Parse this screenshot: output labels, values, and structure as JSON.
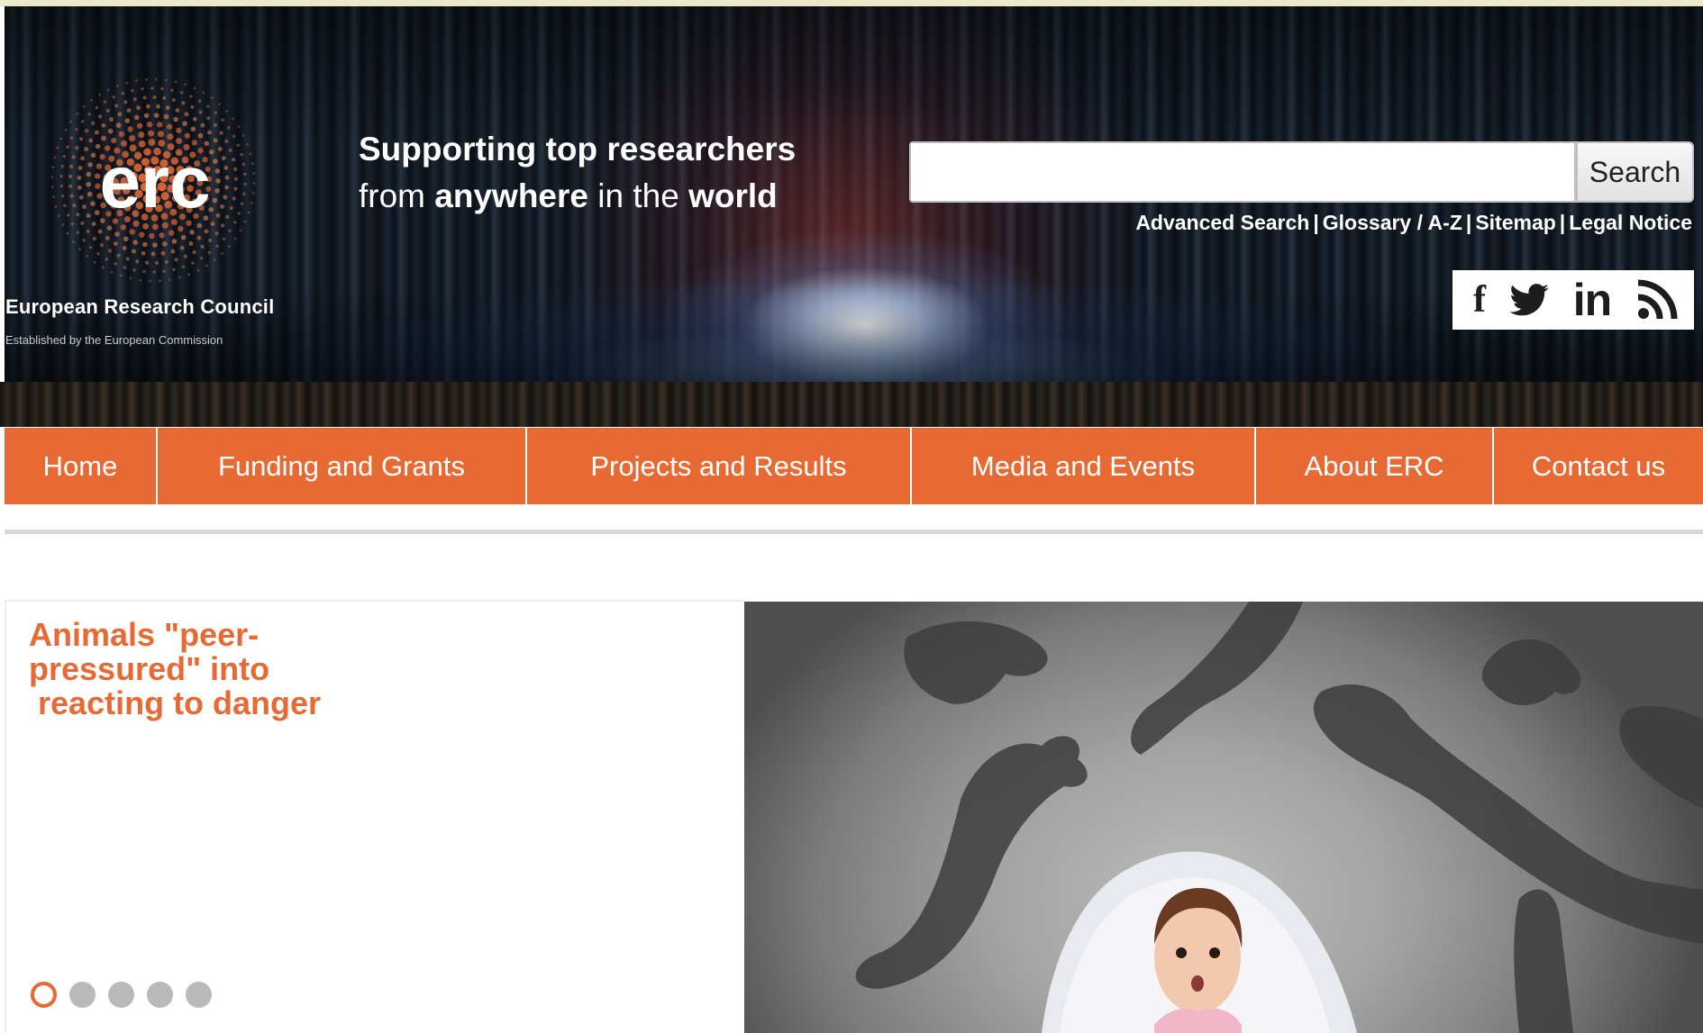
{
  "header": {
    "logo_text": "erc",
    "org_name": "European Research Council",
    "org_subtitle": "Established by the European Commission",
    "tagline": {
      "line1": "Supporting top researchers",
      "line2_prefix": "from ",
      "line2_bold1": "anywhere",
      "line2_mid": " in the ",
      "line2_bold2": "world"
    },
    "search": {
      "value": "",
      "placeholder": "",
      "button_label": "Search"
    },
    "util_links": [
      "Advanced Search",
      "Glossary / A-Z",
      "Sitemap",
      "Legal Notice"
    ],
    "social_icons": [
      "facebook-icon",
      "twitter-icon",
      "linkedin-icon",
      "rss-icon"
    ]
  },
  "nav": {
    "items": [
      {
        "label": "Home"
      },
      {
        "label": "Funding and Grants"
      },
      {
        "label": "Projects and Results"
      },
      {
        "label": "Media and Events"
      },
      {
        "label": "About ERC"
      },
      {
        "label": "Contact us"
      }
    ]
  },
  "slideshow": {
    "title": "Animals \"peer-\npressured\" into\n reacting to danger",
    "slide_count": 5,
    "active_slide": 1
  },
  "colors": {
    "accent": "#e76934",
    "dot_inactive": "#b9b9b9"
  }
}
